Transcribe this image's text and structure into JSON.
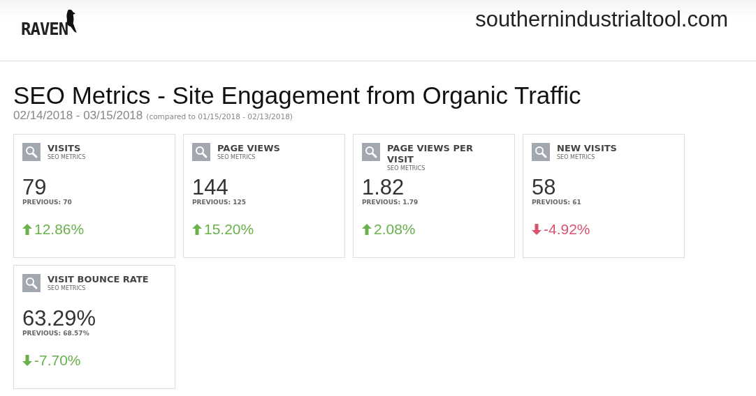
{
  "header": {
    "logo": "RAVEN",
    "domain": "southernindustrialtool.com"
  },
  "report": {
    "title": "SEO Metrics - Site Engagement from Organic Traffic",
    "date_range": "02/14/2018 - 03/15/2018",
    "comparison": "(compared to 01/15/2018 - 02/13/2018)"
  },
  "cards": [
    {
      "title": "VISITS",
      "subtitle": "SEO METRICS",
      "value": "79",
      "previous": "PREVIOUS: 70",
      "change": "12.86%",
      "kind": "up",
      "good": true
    },
    {
      "title": "PAGE VIEWS",
      "subtitle": "SEO METRICS",
      "value": "144",
      "previous": "PREVIOUS: 125",
      "change": "15.20%",
      "kind": "up",
      "good": true
    },
    {
      "title": "PAGE VIEWS PER VISIT",
      "subtitle": "SEO METRICS",
      "value": "1.82",
      "previous": "PREVIOUS: 1.79",
      "change": "2.08%",
      "kind": "up",
      "good": true
    },
    {
      "title": "NEW VISITS",
      "subtitle": "SEO METRICS",
      "value": "58",
      "previous": "PREVIOUS: 61",
      "change": "-4.92%",
      "kind": "down",
      "good": false
    },
    {
      "title": "VISIT BOUNCE RATE",
      "subtitle": "SEO METRICS",
      "value": "63.29%",
      "previous": "PREVIOUS: 68.57%",
      "change": "-7.70%",
      "kind": "down",
      "good": true
    }
  ]
}
